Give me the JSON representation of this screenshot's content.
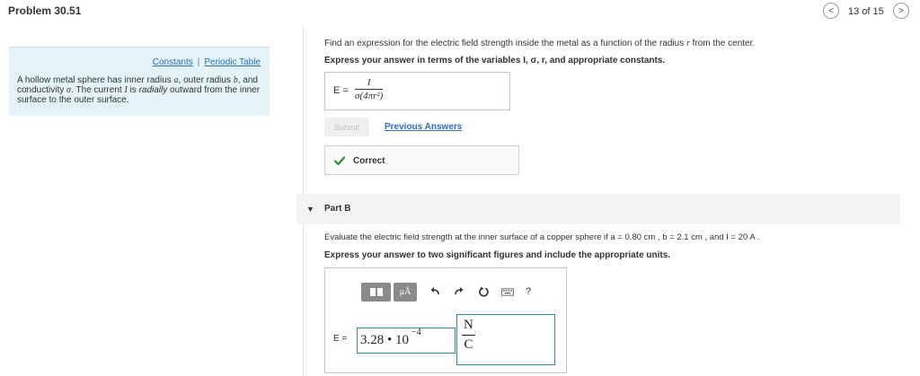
{
  "header": {
    "title": "Problem 30.51",
    "pagination": "13 of 15",
    "prev_glyph": "<",
    "next_glyph": ">"
  },
  "sidebar": {
    "links": [
      "Constants",
      "Periodic Table"
    ],
    "link_separator": "|",
    "problem_text": [
      {
        "t": "A hollow metal sphere has inner radius ",
        "s": "plain"
      },
      {
        "t": "a",
        "s": "math"
      },
      {
        "t": ", outer radius ",
        "s": "plain"
      },
      {
        "t": "b",
        "s": "math"
      },
      {
        "t": ", and conductivity ",
        "s": "plain"
      },
      {
        "t": "σ",
        "s": "math"
      },
      {
        "t": ". The current ",
        "s": "plain"
      },
      {
        "t": "I",
        "s": "math"
      },
      {
        "t": " is ",
        "s": "plain"
      },
      {
        "t": "radially",
        "s": "em"
      },
      {
        "t": " outward from the inner surface to the outer surface.",
        "s": "plain"
      }
    ]
  },
  "part_a": {
    "question": [
      {
        "t": "Find an expression for the electric field strength inside the metal as a function of the radius ",
        "s": "plain"
      },
      {
        "t": "r",
        "s": "math"
      },
      {
        "t": " from the center.",
        "s": "plain"
      }
    ],
    "instruction": "Express your answer in terms of the variables I, σ, r, and appropriate constants.",
    "answer_label": "E =",
    "answer_numerator": "I",
    "answer_denominator": "σ(4πr²)",
    "submit_label": "Submit",
    "previous_answers_label": "Previous Answers",
    "feedback": "Correct"
  },
  "part_b": {
    "title": "Part B",
    "question": "Evaluate the electric field strength at the inner surface of a copper sphere if a = 0.80 cm , b = 2.1 cm , and I = 20 A .",
    "instruction": "Express your answer to two significant figures and include the appropriate units.",
    "editor": {
      "units_button": "μÅ",
      "help": "?",
      "answer_label": "E =",
      "value": "3.28 • 10",
      "exponent": "−4",
      "unit_numerator": "N",
      "unit_denominator": "C"
    }
  },
  "colors": {
    "link": "#2a6fb5",
    "info_background": "#e4f3f8",
    "correct_check": "#2e8b2e",
    "field_border": "#2a8f8f"
  }
}
